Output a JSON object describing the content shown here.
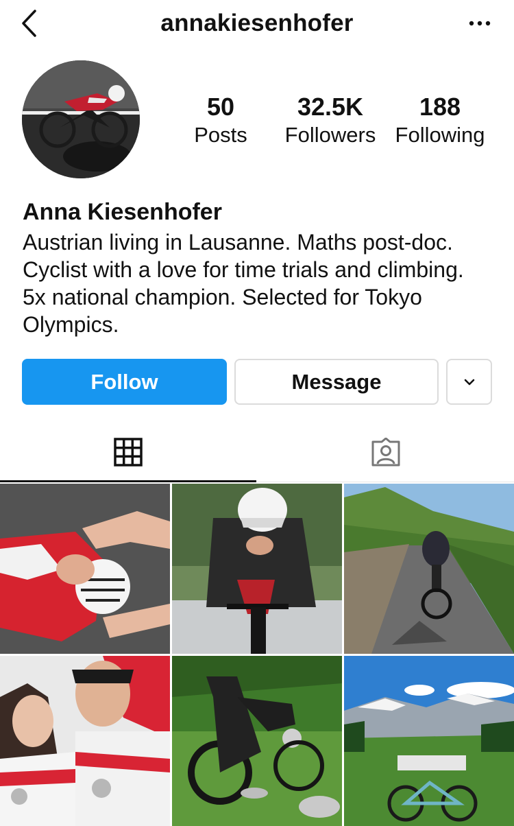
{
  "header": {
    "username": "annakiesenhofer"
  },
  "profile": {
    "stats": [
      {
        "value": "50",
        "label": "Posts"
      },
      {
        "value": "32.5K",
        "label": "Followers"
      },
      {
        "value": "188",
        "label": "Following"
      }
    ],
    "full_name": "Anna Kiesenhofer",
    "bio": "Austrian living in Lausanne. Maths post-doc. Cyclist with a love for time trials and climbing. 5x national champion. Selected for Tokyo Olympics."
  },
  "actions": {
    "follow_label": "Follow",
    "message_label": "Message"
  },
  "tabs": [
    {
      "name": "posts-grid",
      "icon": "grid-icon",
      "active": true
    },
    {
      "name": "tagged",
      "icon": "tagged-person-icon",
      "active": false
    }
  ],
  "posts": [
    {
      "icon": "photo-austria-jersey"
    },
    {
      "icon": "photo-time-trial-rider"
    },
    {
      "icon": "photo-vineyard-road"
    },
    {
      "icon": "photo-podium-medals"
    },
    {
      "icon": "photo-tt-bike-garden"
    },
    {
      "icon": "photo-mountain-bike-view"
    }
  ],
  "colors": {
    "accent": "#1796f0",
    "border": "#dbdbdb",
    "text": "#111111"
  }
}
